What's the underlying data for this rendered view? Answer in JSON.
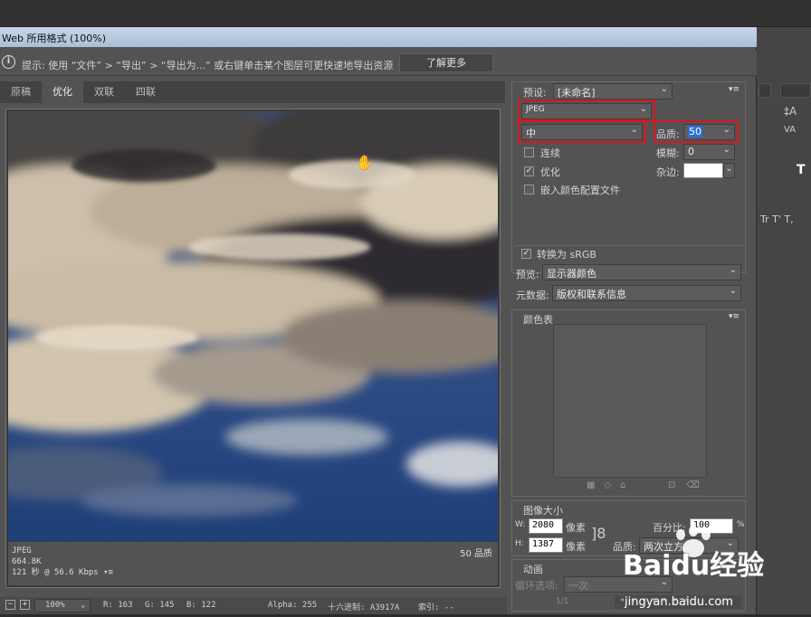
{
  "dialog": {
    "title": "Web 所用格式 (100%)"
  },
  "hint": {
    "text": "提示: 使用 “文件” > “导出” > “导出为...” 或右键单击某个图层可更快速地导出资源",
    "learn_more": "了解更多"
  },
  "tabs": [
    {
      "label": "原稿"
    },
    {
      "label": "优化"
    },
    {
      "label": "双联"
    },
    {
      "label": "四联"
    }
  ],
  "preview_info": {
    "format": "JPEG",
    "size": "664.8K",
    "time": "121 秒 @ 56.6 Kbps",
    "quality": "50 品质"
  },
  "status": {
    "zoom": "100%",
    "r": "R: 163",
    "g": "G: 145",
    "b": "B: 122",
    "alpha": "Alpha: 255",
    "hex": "十六进制: A3917A",
    "index": "索引: --"
  },
  "preset": {
    "label": "预设:",
    "value": "[未命名]"
  },
  "settings": {
    "format": "JPEG",
    "compression": "中",
    "quality_label": "品质:",
    "quality_value": "50",
    "blur_label": "模糊:",
    "blur_value": "0",
    "matte_label": "杂边:",
    "progressive": "连续",
    "optimized": "优化",
    "embed_profile": "嵌入颜色配置文件",
    "convert_srgb": "转换为 sRGB",
    "preview_label": "预览:",
    "preview_value": "显示器颜色",
    "metadata_label": "元数据:",
    "metadata_value": "版权和联系信息"
  },
  "color_table": {
    "title": "颜色表"
  },
  "image_size": {
    "title": "图像大小",
    "w_label": "W:",
    "w_value": "2080",
    "h_label": "H:",
    "h_value": "1387",
    "unit": "像素",
    "percent_label": "百分比:",
    "percent_value": "100",
    "percent_unit": "%",
    "quality_label": "品质:",
    "quality_value": "两次立方"
  },
  "animation": {
    "title": "动画",
    "loop_label": "循环选项:",
    "loop_value": "一次",
    "frame": "1/1"
  },
  "watermark": {
    "text": "Baidu经验",
    "url": "jingyan.baidu.com"
  },
  "colors": {
    "highlight": "#d8161d",
    "dialog_bg": "#535353",
    "titlebar": "#b6c9df"
  }
}
